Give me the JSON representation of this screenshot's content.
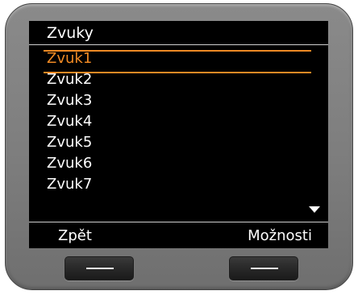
{
  "screen": {
    "title": "Zvuky",
    "items": [
      {
        "label": "Zvuk1",
        "selected": true
      },
      {
        "label": "Zvuk2",
        "selected": false
      },
      {
        "label": "Zvuk3",
        "selected": false
      },
      {
        "label": "Zvuk4",
        "selected": false
      },
      {
        "label": "Zvuk5",
        "selected": false
      },
      {
        "label": "Zvuk6",
        "selected": false
      },
      {
        "label": "Zvuk7",
        "selected": false
      }
    ],
    "softkeys": {
      "left": "Zpět",
      "right": "Možnosti"
    }
  },
  "icons": {
    "scroll": "chevron-down-icon",
    "hardware_key": "softkey-dash-icon"
  },
  "colors": {
    "screen_background": "#000000",
    "selection_accent": "#f08a24",
    "text": "#ffffff",
    "bezel": "#808080"
  }
}
